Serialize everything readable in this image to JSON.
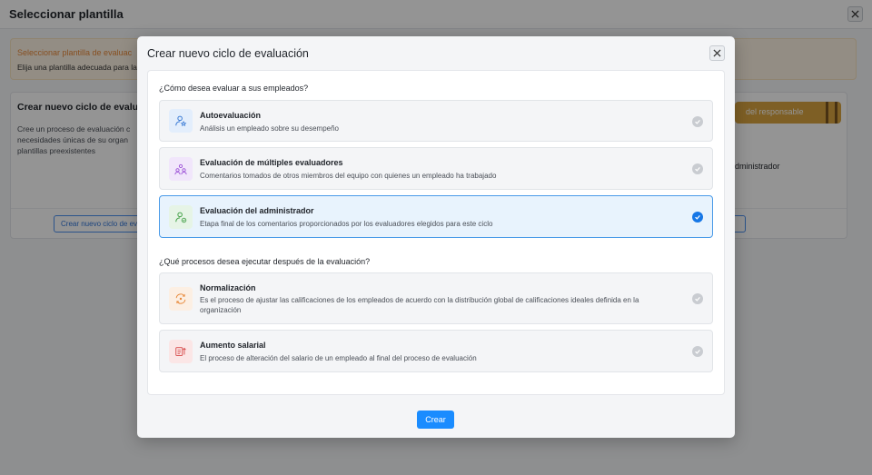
{
  "background": {
    "title": "Seleccionar plantilla",
    "notice": {
      "title": "Seleccionar plantilla de evaluac",
      "text": "Elija una plantilla adecuada para la"
    },
    "card": {
      "title": "Crear nuevo ciclo de evalua",
      "description": "Cree un proceso de evaluación c necesidades únicas de su organ plantillas preexistentes",
      "button_label": "Crear nuevo ciclo de eva",
      "right_banner": "del responsable",
      "right_text": "dministrador"
    }
  },
  "modal": {
    "title": "Crear nuevo ciclo de evaluación",
    "question1": "¿Cómo desea evaluar a sus empleados?",
    "evaluation_options": [
      {
        "title": "Autoevaluación",
        "description": "Análisis un empleado sobre su desempeño",
        "icon": "user-star-icon",
        "selected": false
      },
      {
        "title": "Evaluación de múltiples evaluadores",
        "description": "Comentarios tomados de otros miembros del equipo con quienes un empleado ha trabajado",
        "icon": "group-icon",
        "selected": false
      },
      {
        "title": "Evaluación del administrador",
        "description": "Etapa final de los comentarios proporcionados por los evaluadores elegidos para este ciclo",
        "icon": "user-check-icon",
        "selected": true
      }
    ],
    "question2": "¿Qué procesos desea ejecutar después de la evaluación?",
    "process_options": [
      {
        "title": "Normalización",
        "description": "Es el proceso de ajustar las calificaciones de los empleados de acuerdo con la distribución global de calificaciones ideales definida en la organización",
        "icon": "normalize-icon",
        "selected": false
      },
      {
        "title": "Aumento salarial",
        "description": "El proceso de alteración del salario de un empleado al final del proceso de evaluación",
        "icon": "salary-icon",
        "selected": false
      }
    ],
    "submit_label": "Crear"
  },
  "colors": {
    "accent": "#1a8cff",
    "selected_border": "#4a9be8",
    "selected_bg": "#e8f3fd",
    "warning": "#e8893a"
  }
}
